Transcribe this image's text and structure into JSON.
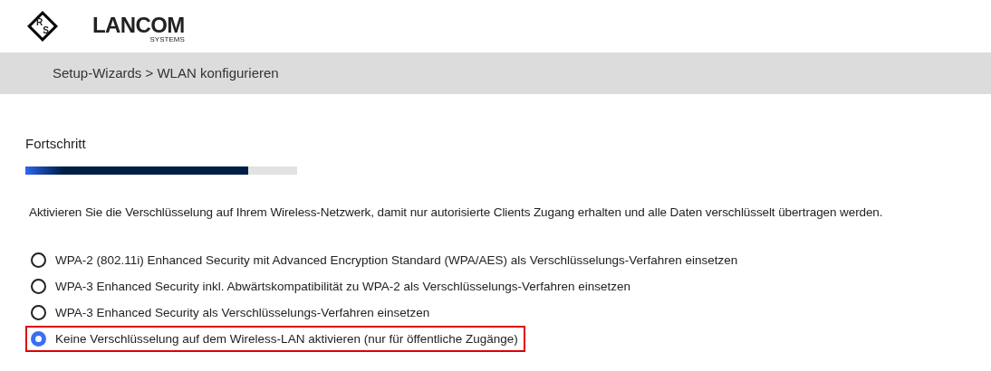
{
  "logo": {
    "emblem_letters": [
      "R",
      "S"
    ],
    "name": "LANCOM",
    "subtitle": "SYSTEMS"
  },
  "breadcrumb": "Setup-Wizards > WLAN konfigurieren",
  "progress": {
    "label": "Fortschritt",
    "level": 0.82
  },
  "description": "Aktivieren Sie die Verschlüsselung auf Ihrem Wireless-Netzwerk, damit nur autorisierte Clients Zugang erhalten und alle Daten verschlüsselt übertragen werden.",
  "options": [
    {
      "label": "WPA-2 (802.11i) Enhanced Security mit Advanced Encryption Standard (WPA/AES) als Verschlüsselungs-Verfahren einsetzen",
      "selected": false
    },
    {
      "label": "WPA-3 Enhanced Security inkl. Abwärtskompatibilität zu WPA-2 als Verschlüsselungs-Verfahren einsetzen",
      "selected": false
    },
    {
      "label": "WPA-3 Enhanced Security als Verschlüsselungs-Verfahren einsetzen",
      "selected": false
    },
    {
      "label": "Keine Verschlüsselung auf dem Wireless-LAN aktivieren (nur für öffentliche Zugänge)",
      "selected": true
    }
  ]
}
